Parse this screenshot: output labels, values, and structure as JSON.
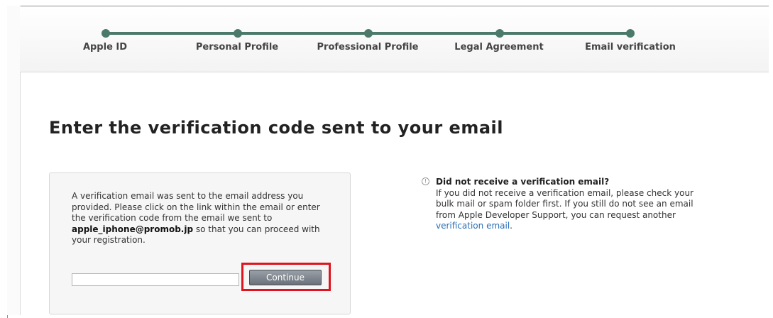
{
  "steps": [
    {
      "label": "Apple ID"
    },
    {
      "label": "Personal Profile"
    },
    {
      "label": "Professional Profile"
    },
    {
      "label": "Legal Agreement"
    },
    {
      "label": "Email verification"
    }
  ],
  "page_title": "Enter the verification code sent to your email",
  "verification": {
    "text_before": "A verification email was sent to the email address you provided. Please click on the link within the email or enter the verification code from the email we sent to ",
    "email": "apple_iphone@promob.jp",
    "text_after": " so that you can proceed with your registration.",
    "input_value": "",
    "input_placeholder": "",
    "continue_label": "Continue"
  },
  "help": {
    "icon": "info-icon",
    "title": "Did not receive a verification email?",
    "body": "If you did not receive a verification email, please check your bulk mail or spam folder first. If you still do not see an email from Apple Developer Support, you can request another ",
    "link_label": "verification email",
    "suffix": "."
  },
  "colors": {
    "progress": "#4b7a6a",
    "link": "#2a6fb5",
    "highlight": "#e0141e",
    "button": "#6b717a"
  }
}
